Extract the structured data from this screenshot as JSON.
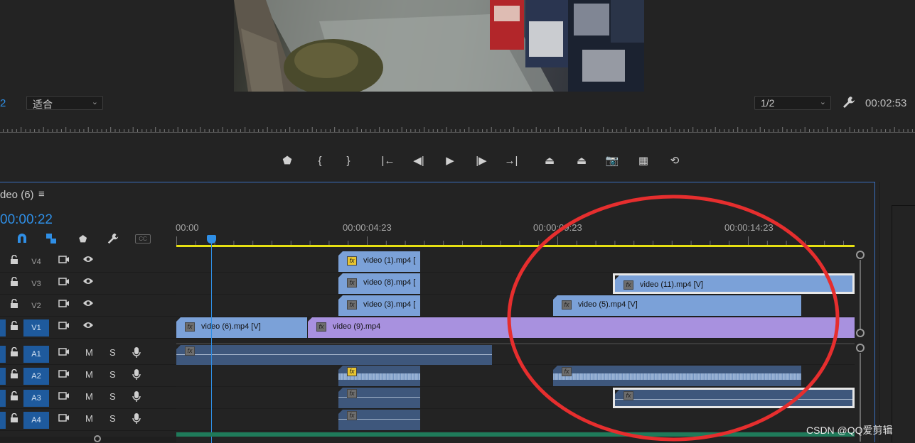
{
  "monitor": {
    "left_number": "2",
    "fit_label": "适合",
    "resolution": "1/2",
    "timecode": "00:02:53"
  },
  "transport": {
    "buttons": [
      {
        "name": "add-marker-button",
        "glyph": "⬟"
      },
      {
        "name": "mark-in-button",
        "glyph": "{"
      },
      {
        "name": "mark-out-button",
        "glyph": "}"
      },
      {
        "name": "go-to-in-button",
        "glyph": "|←"
      },
      {
        "name": "step-back-button",
        "glyph": "◀|"
      },
      {
        "name": "play-button",
        "glyph": "▶"
      },
      {
        "name": "step-forward-button",
        "glyph": "|▶"
      },
      {
        "name": "go-to-out-button",
        "glyph": "→|"
      },
      {
        "name": "lift-button",
        "glyph": "⏏"
      },
      {
        "name": "extract-button",
        "glyph": "⏏"
      },
      {
        "name": "export-frame-button",
        "glyph": "📷"
      },
      {
        "name": "insert-button",
        "glyph": "▦"
      },
      {
        "name": "overwrite-button",
        "glyph": "⟲"
      }
    ]
  },
  "timeline": {
    "sequence_name": "deo (6)",
    "menu_glyph": "≡",
    "current_time": "00:00:22",
    "tick_labels": [
      "00:00",
      "00:00:04:23",
      "00:00:09:23",
      "00:00:14:23"
    ],
    "tracks": [
      {
        "label": "V4",
        "type": "video",
        "targeted": false
      },
      {
        "label": "V3",
        "type": "video",
        "targeted": false
      },
      {
        "label": "V2",
        "type": "video",
        "targeted": false
      },
      {
        "label": "V1",
        "type": "video",
        "targeted": true
      },
      {
        "label": "A1",
        "type": "audio",
        "targeted": true
      },
      {
        "label": "A2",
        "type": "audio",
        "targeted": true
      },
      {
        "label": "A3",
        "type": "audio",
        "targeted": true
      },
      {
        "label": "A4",
        "type": "audio",
        "targeted": true
      }
    ],
    "mute_label": "M",
    "solo_label": "S",
    "clips": [
      {
        "track": "V4",
        "name": "video (1).mp4 [",
        "fx_yellow": true
      },
      {
        "track": "V3",
        "name": "video (8).mp4 [",
        "fx_yellow": false
      },
      {
        "track": "V3",
        "name": "video (11).mp4 [V]",
        "fx_yellow": false
      },
      {
        "track": "V2",
        "name": "video (3).mp4 [",
        "fx_yellow": false
      },
      {
        "track": "V2",
        "name": "video (5).mp4 [V]",
        "fx_yellow": false
      },
      {
        "track": "V1",
        "name": "video (6).mp4 [V]",
        "fx_yellow": false
      },
      {
        "track": "V1",
        "name": "video (9).mp4",
        "fx_yellow": false
      }
    ]
  },
  "watermark": "CSDN @QQ爱剪辑",
  "colors": {
    "accent_blue": "#2f8fe6",
    "video_clip": "#7ba1d8",
    "v1_clip": "#a891df",
    "audio_clip": "#3e577c",
    "work_area": "#e6e012",
    "annotation_red": "#e62e2e"
  }
}
